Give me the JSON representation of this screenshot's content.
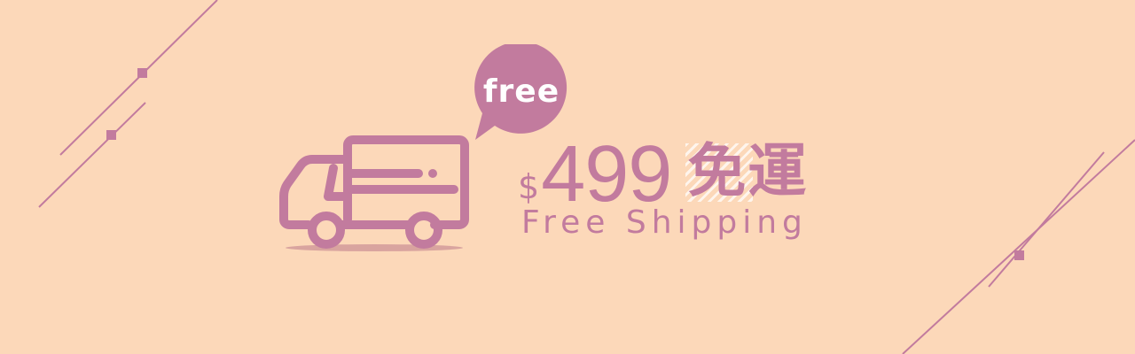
{
  "colors": {
    "background": "#fcd8b9",
    "accent": "#c27b9e",
    "shadow": "#d9a49f",
    "bubble_text": "#ffffff"
  },
  "bubble": {
    "label": "free"
  },
  "price": {
    "currency": "$",
    "amount": "499",
    "label_zh": "免運"
  },
  "subtitle": "Free Shipping",
  "icons": {
    "truck": "delivery-truck-icon",
    "bubble": "speech-bubble-icon"
  }
}
